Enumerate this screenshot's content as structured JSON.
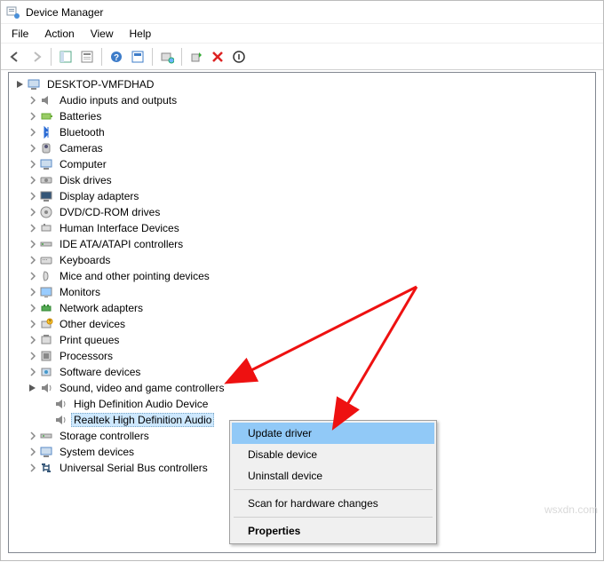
{
  "window": {
    "title": "Device Manager"
  },
  "menu": {
    "file": "File",
    "action": "Action",
    "view": "View",
    "help": "Help"
  },
  "tree": {
    "root": "DESKTOP-VMFDHAD",
    "items": [
      "Audio inputs and outputs",
      "Batteries",
      "Bluetooth",
      "Cameras",
      "Computer",
      "Disk drives",
      "Display adapters",
      "DVD/CD-ROM drives",
      "Human Interface Devices",
      "IDE ATA/ATAPI controllers",
      "Keyboards",
      "Mice and other pointing devices",
      "Monitors",
      "Network adapters",
      "Other devices",
      "Print queues",
      "Processors",
      "Software devices"
    ],
    "expanded": {
      "label": "Sound, video and game controllers",
      "children": [
        "High Definition Audio Device",
        "Realtek High Definition Audio"
      ]
    },
    "after": [
      "Storage controllers",
      "System devices",
      "Universal Serial Bus controllers"
    ]
  },
  "context_menu": {
    "update": "Update driver",
    "disable": "Disable device",
    "uninstall": "Uninstall device",
    "scan": "Scan for hardware changes",
    "properties": "Properties"
  },
  "watermark": "wsxdn.com"
}
